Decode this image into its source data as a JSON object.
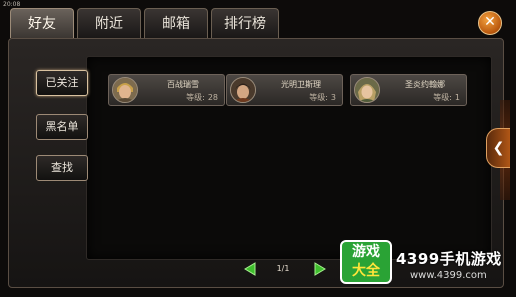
{
  "status": {
    "time": "20:08"
  },
  "tabs": [
    {
      "label": "好友",
      "active": true
    },
    {
      "label": "附近",
      "active": false
    },
    {
      "label": "邮箱",
      "active": false
    },
    {
      "label": "排行榜",
      "active": false
    }
  ],
  "close": {
    "glyph": "✕"
  },
  "side_buttons": [
    {
      "label": "已关注",
      "selected": true
    },
    {
      "label": "黑名单",
      "selected": false
    },
    {
      "label": "查找",
      "selected": false
    }
  ],
  "friends": [
    {
      "name": "百战瑞雪",
      "level_label": "等级:",
      "level": "28"
    },
    {
      "name": "光明卫斯理",
      "level_label": "等级:",
      "level": "3"
    },
    {
      "name": "圣炎约翰娜",
      "level_label": "等级:",
      "level": "1"
    }
  ],
  "pager": {
    "text": "1/1"
  },
  "collapse": {
    "glyph": "❮"
  },
  "watermark": {
    "badge_line1": "游戏",
    "badge_line2": "大全",
    "title": "4399手机游戏",
    "url": "www.4399.com"
  },
  "colors": {
    "accent_orange": "#d2731c",
    "pager_green": "#3fbf2e",
    "watermark_green": "#2aa335"
  }
}
